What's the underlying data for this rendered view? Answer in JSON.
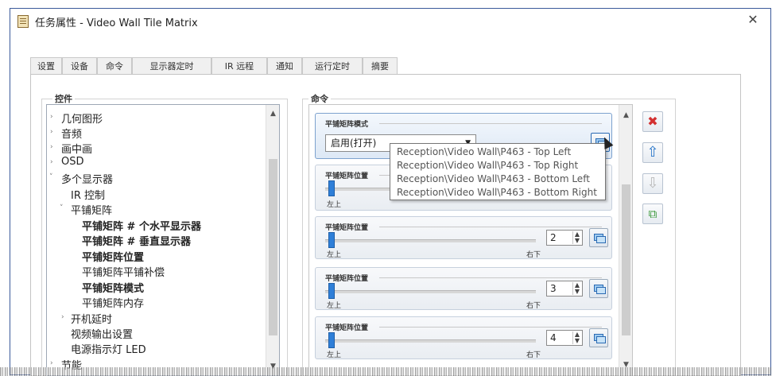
{
  "window": {
    "title": "任务属性 - Video Wall Tile Matrix",
    "close_glyph": "✕"
  },
  "tabs": [
    "设置",
    "设备",
    "命令",
    "显示器定时",
    "IR 远程",
    "通知",
    "运行定时",
    "摘要"
  ],
  "active_tab": "命令",
  "controls_panel": {
    "label": "控件",
    "tree": [
      {
        "label": "几何图形",
        "arrow": "›"
      },
      {
        "label": "音频",
        "arrow": "›"
      },
      {
        "label": "画中画",
        "arrow": "›"
      },
      {
        "label": "OSD",
        "arrow": "›"
      },
      {
        "label": "多个显示器",
        "arrow": "˅"
      },
      {
        "label": "IR 控制",
        "arrow": ""
      },
      {
        "label": "平铺矩阵",
        "arrow": "˅"
      },
      {
        "label": "平铺矩阵 # 个水平显示器",
        "arrow": ""
      },
      {
        "label": "平铺矩阵 # 垂直显示器",
        "arrow": ""
      },
      {
        "label": "平铺矩阵位置",
        "arrow": ""
      },
      {
        "label": "平铺矩阵平铺补偿",
        "arrow": ""
      },
      {
        "label": "平铺矩阵模式",
        "arrow": ""
      },
      {
        "label": "平铺矩阵内存",
        "arrow": ""
      },
      {
        "label": "开机延时",
        "arrow": "›"
      },
      {
        "label": "视频输出设置",
        "arrow": ""
      },
      {
        "label": "电源指示灯 LED",
        "arrow": ""
      },
      {
        "label": "节能",
        "arrow": "›"
      }
    ]
  },
  "commands_panel": {
    "label": "命令",
    "mode_card": {
      "title": "平铺矩阵模式",
      "dropdown_value": "启用(打开)"
    },
    "position_cards": [
      {
        "title": "平铺矩阵位置",
        "left_label": "左上",
        "right_label": "",
        "value": ""
      },
      {
        "title": "平铺矩阵位置",
        "left_label": "左上",
        "right_label": "右下",
        "value": "2"
      },
      {
        "title": "平铺矩阵位置",
        "left_label": "左上",
        "right_label": "右下",
        "value": "3"
      },
      {
        "title": "平铺矩阵位置",
        "left_label": "左上",
        "right_label": "右下",
        "value": "4"
      }
    ],
    "popup_items": [
      "Reception\\Video Wall\\P463 - Top Left",
      "Reception\\Video Wall\\P463 - Top Right",
      "Reception\\Video Wall\\P463 - Bottom Left",
      "Reception\\Video Wall\\P463 - Bottom Right"
    ]
  },
  "side_buttons": [
    {
      "name": "delete",
      "glyph": "✖",
      "color": "#d33030"
    },
    {
      "name": "move-up",
      "glyph": "⇧",
      "color": "#2a76c9"
    },
    {
      "name": "move-down",
      "glyph": "⇩",
      "color": "#b9b9b9"
    },
    {
      "name": "copy",
      "glyph": "⧉",
      "color": "#3c9a3c"
    }
  ],
  "scroll": {
    "up": "▲",
    "down": "▼"
  }
}
